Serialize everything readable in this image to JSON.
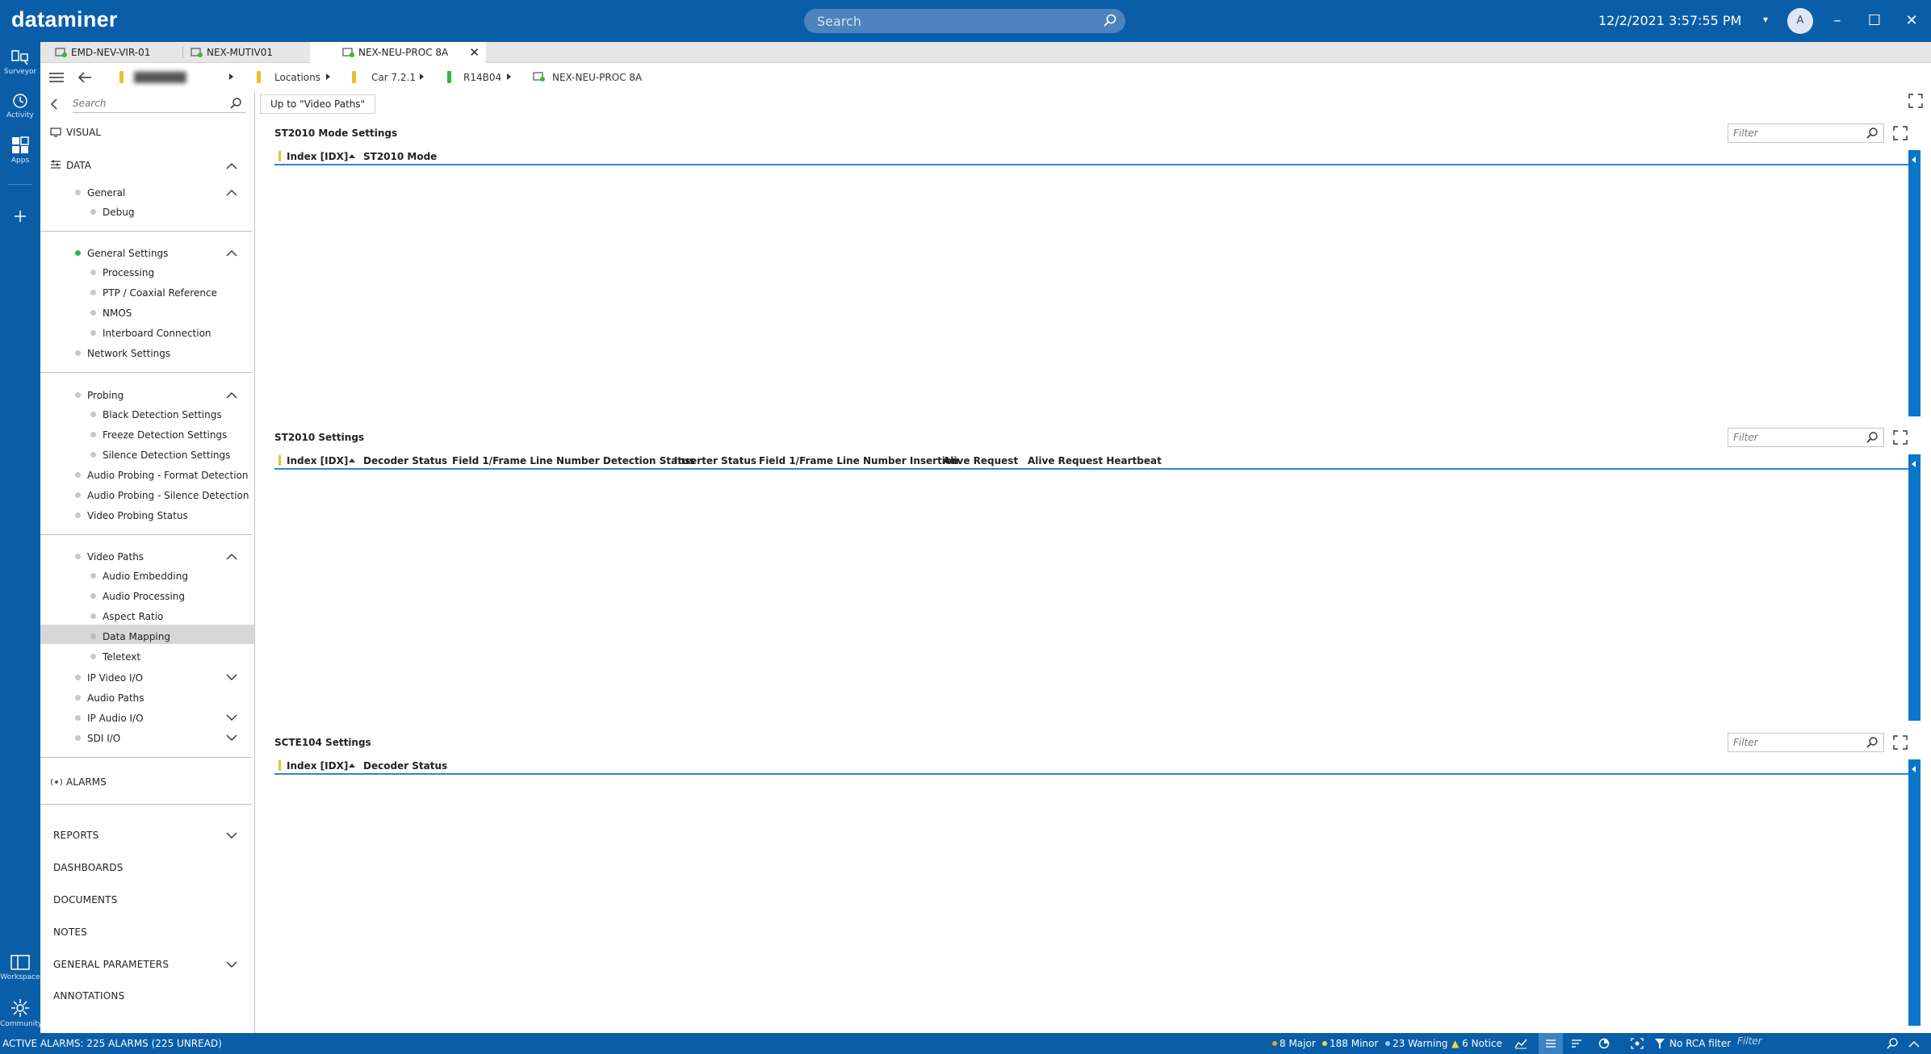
{
  "app": {
    "brand": "dataminer",
    "search_placeholder": "Search",
    "datetime": "12/2/2021 3:57:55 PM",
    "avatar_initial": "A",
    "window_controls": {
      "minimize": "–",
      "maximize": "☐",
      "close": "✕"
    }
  },
  "rail": {
    "items": [
      {
        "label": "Surveyor",
        "icon": "surveyor-icon"
      },
      {
        "label": "Activity",
        "icon": "activity-icon"
      },
      {
        "label": "Apps",
        "icon": "apps-icon"
      },
      {
        "label": "",
        "icon": "add-icon"
      }
    ],
    "bottom": [
      {
        "label": "Workspace",
        "icon": "workspace-icon"
      },
      {
        "label": "Community",
        "icon": "community-icon"
      }
    ]
  },
  "tabs": [
    {
      "label": "EMD-NEV-VIR-01"
    },
    {
      "label": "NEX-MUTIV01"
    },
    {
      "label": "NEX-NEU-PROC 8A",
      "active": true
    }
  ],
  "breadcrumb": {
    "items": [
      "Locations",
      "Car 7.2.1",
      "R14B04",
      "NEX-NEU-PROC 8A"
    ],
    "colors": {
      "yellow": "#e6c12e",
      "green": "#38b448"
    }
  },
  "nav": {
    "search_placeholder": "Search",
    "visual": "VISUAL",
    "data": "DATA",
    "items": {
      "general": "General",
      "debug": "Debug",
      "general_settings": "General Settings",
      "processing": "Processing",
      "ptp": "PTP / Coaxial Reference",
      "nmos": "NMOS",
      "interboard": "Interboard Connection",
      "network_settings": "Network Settings",
      "probing": "Probing",
      "black_detection": "Black Detection Settings",
      "freeze_detection": "Freeze Detection Settings",
      "silence_detection": "Silence Detection Settings",
      "audio_format": "Audio Probing - Format Detection",
      "audio_silence": "Audio Probing - Silence Detection",
      "video_probing_status": "Video Probing Status",
      "video_paths": "Video Paths",
      "audio_embedding": "Audio Embedding",
      "audio_processing": "Audio Processing",
      "aspect_ratio": "Aspect Ratio",
      "data_mapping": "Data Mapping",
      "teletext": "Teletext",
      "ip_video_io": "IP Video I/O",
      "audio_paths": "Audio Paths",
      "ip_audio_io": "IP Audio I/O",
      "sdi_io": "SDI I/O"
    },
    "alarms": "ALARMS",
    "sections": {
      "reports": "REPORTS",
      "dashboards": "DASHBOARDS",
      "documents": "DOCUMENTS",
      "notes": "NOTES",
      "general_parameters": "GENERAL PARAMETERS",
      "annotations": "ANNOTATIONS"
    }
  },
  "main": {
    "up_button": "Up to \"Video Paths\"",
    "filter_placeholder": "Filter",
    "tables": [
      {
        "title": "ST2010 Mode Settings",
        "columns": [
          "Index [IDX]",
          "ST2010 Mode"
        ]
      },
      {
        "title": "ST2010 Settings",
        "columns": [
          "Index [IDX]",
          "Decoder Status",
          "Field 1/Frame Line Number Detection Status",
          "Inserter Status",
          "Field 1/Frame Line Number Insertion",
          "Alive Request",
          "Alive Request Heartbeat"
        ]
      },
      {
        "title": "SCTE104 Settings",
        "columns": [
          "Index [IDX]",
          "Decoder Status"
        ]
      }
    ]
  },
  "statusbar": {
    "active_alarms": "ACTIVE ALARMS: 225 ALARMS (225 UNREAD)",
    "major": "8 Major",
    "minor": "188 Minor",
    "warning": "23 Warning",
    "notice": "6 Notice",
    "rca": "No RCA filter",
    "filter_placeholder": "Filter",
    "colors": {
      "major": "#f0a020",
      "minor": "#f5d44a",
      "warning": "#9ec7f0",
      "notice": "#f5d44a"
    }
  }
}
